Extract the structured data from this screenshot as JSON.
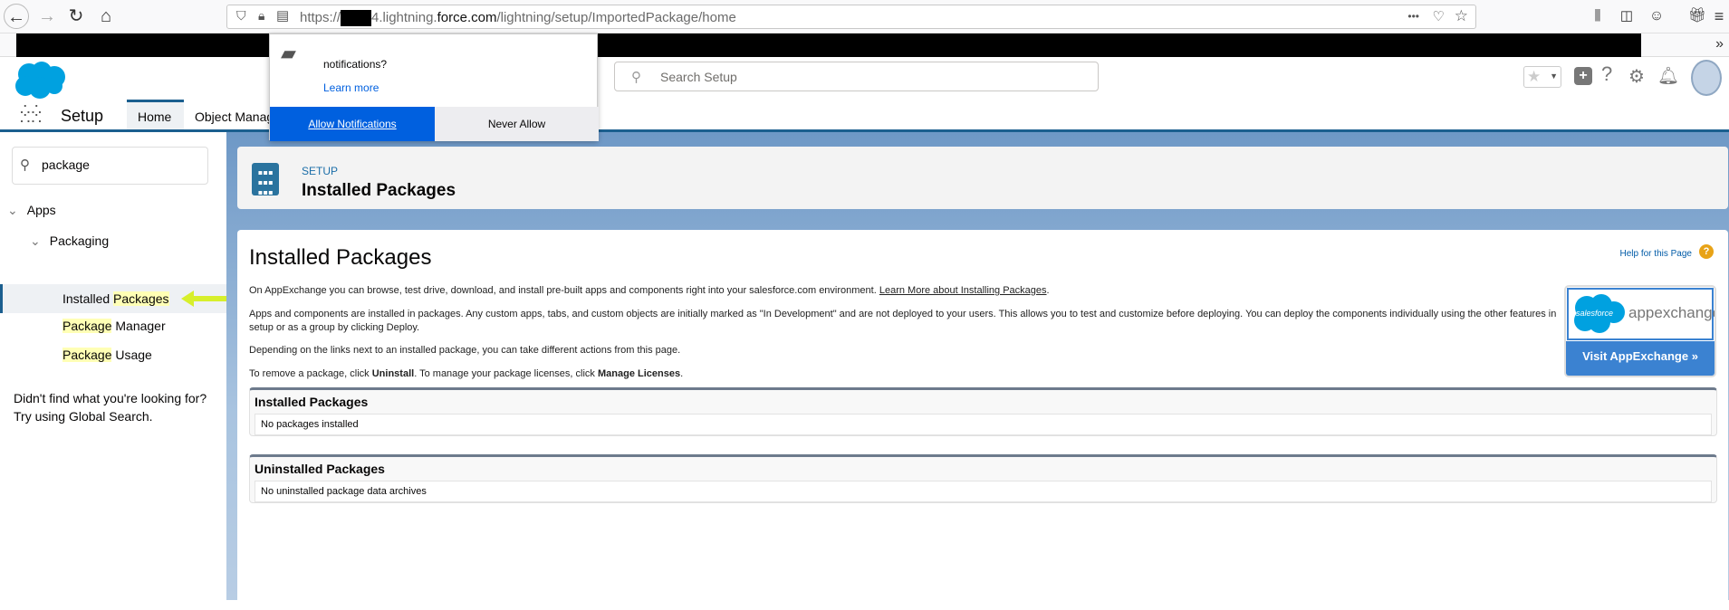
{
  "browser": {
    "url_prefix": "https://",
    "url_domain_mid": "4.lightning.",
    "url_domain": "force.com",
    "url_path": "/lightning/setup/ImportedPackage/home",
    "menu_dots": "•••"
  },
  "popup": {
    "question": "notifications?",
    "learn_more": "Learn more",
    "allow": "Allow Notifications",
    "never": "Never Allow"
  },
  "header": {
    "search_placeholder": "Search Setup"
  },
  "nav": {
    "app_name": "Setup",
    "tabs": [
      "Home",
      "Object Manager"
    ]
  },
  "sidebar": {
    "search_value": "package",
    "tree": {
      "apps": "Apps",
      "packaging": "Packaging",
      "items": [
        {
          "pre": "Installed ",
          "hl": "Packages",
          "post": ""
        },
        {
          "pre": "",
          "hl": "Package",
          "post": " Manager"
        },
        {
          "pre": "",
          "hl": "Package",
          "post": " Usage"
        }
      ]
    },
    "not_found_1": "Didn't find what you're looking for?",
    "not_found_2": "Try using Global Search."
  },
  "page_header": {
    "eyebrow": "SETUP",
    "title": "Installed Packages"
  },
  "content": {
    "title": "Installed Packages",
    "help": "Help for this Page",
    "p1": "On AppExchange you can browse, test drive, download, and install pre-built apps and components right into your salesforce.com environment. ",
    "p1_link": "Learn More about Installing Packages",
    "p2": "Apps and components are installed in packages. Any custom apps, tabs, and custom objects are initially marked as \"In Development\" and are not deployed to your users. This allows you to test and customize before deploying. You can deploy the components individually using the other features in setup or as a group by clicking Deploy.",
    "p3": "Depending on the links next to an installed package, you can take different actions from this page.",
    "p4_a": "To remove a package, click ",
    "p4_b": "Uninstall",
    "p4_c": ". To manage your package licenses, click ",
    "p4_d": "Manage Licenses",
    "p4_e": ".",
    "appexchange": {
      "logo_text": "salesforce",
      "brand": "appexchange",
      "button": "Visit AppExchange »"
    },
    "sections": [
      {
        "title": "Installed Packages",
        "empty": "No packages installed"
      },
      {
        "title": "Uninstalled Packages",
        "empty": "No uninstalled package data archives"
      }
    ]
  },
  "colors": {
    "brand": "#00a1e0",
    "popup_allow": "#0060df",
    "header_icon": "#2a739e",
    "arrow": "#d7ef2b"
  }
}
